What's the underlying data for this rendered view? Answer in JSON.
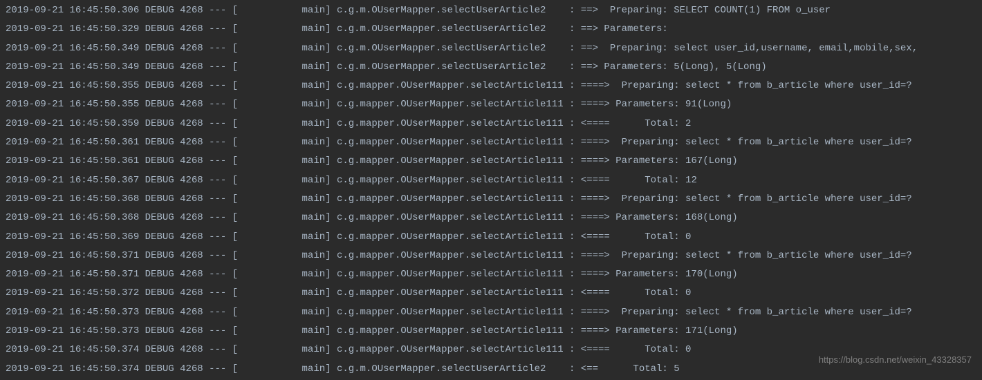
{
  "watermark": "https://blog.csdn.net/weixin_43328357",
  "log_lines": [
    {
      "ts": "2019-09-21 16:45:50.306",
      "level": "DEBUG",
      "pid": "4268",
      "sep": "---",
      "thread": "[           main]",
      "logger": "c.g.m.OUserMapper.selectUserArticle2    ",
      "arrow": ": ==> ",
      "msg": " Preparing: SELECT COUNT(1) FROM o_user "
    },
    {
      "ts": "2019-09-21 16:45:50.329",
      "level": "DEBUG",
      "pid": "4268",
      "sep": "---",
      "thread": "[           main]",
      "logger": "c.g.m.OUserMapper.selectUserArticle2    ",
      "arrow": ": ==> ",
      "msg": "Parameters: "
    },
    {
      "ts": "2019-09-21 16:45:50.349",
      "level": "DEBUG",
      "pid": "4268",
      "sep": "---",
      "thread": "[           main]",
      "logger": "c.g.m.OUserMapper.selectUserArticle2    ",
      "arrow": ": ==> ",
      "msg": " Preparing: select user_id,username, email,mobile,sex,"
    },
    {
      "ts": "2019-09-21 16:45:50.349",
      "level": "DEBUG",
      "pid": "4268",
      "sep": "---",
      "thread": "[           main]",
      "logger": "c.g.m.OUserMapper.selectUserArticle2    ",
      "arrow": ": ==> ",
      "msg": "Parameters: 5(Long), 5(Long)"
    },
    {
      "ts": "2019-09-21 16:45:50.355",
      "level": "DEBUG",
      "pid": "4268",
      "sep": "---",
      "thread": "[           main]",
      "logger": "c.g.mapper.OUserMapper.selectArticle111 ",
      "arrow": ": ====> ",
      "msg": " Preparing: select * from b_article where user_id=?"
    },
    {
      "ts": "2019-09-21 16:45:50.355",
      "level": "DEBUG",
      "pid": "4268",
      "sep": "---",
      "thread": "[           main]",
      "logger": "c.g.mapper.OUserMapper.selectArticle111 ",
      "arrow": ": ====> ",
      "msg": "Parameters: 91(Long)"
    },
    {
      "ts": "2019-09-21 16:45:50.359",
      "level": "DEBUG",
      "pid": "4268",
      "sep": "---",
      "thread": "[           main]",
      "logger": "c.g.mapper.OUserMapper.selectArticle111 ",
      "arrow": ": <====  ",
      "msg": "    Total: 2"
    },
    {
      "ts": "2019-09-21 16:45:50.361",
      "level": "DEBUG",
      "pid": "4268",
      "sep": "---",
      "thread": "[           main]",
      "logger": "c.g.mapper.OUserMapper.selectArticle111 ",
      "arrow": ": ====> ",
      "msg": " Preparing: select * from b_article where user_id=?"
    },
    {
      "ts": "2019-09-21 16:45:50.361",
      "level": "DEBUG",
      "pid": "4268",
      "sep": "---",
      "thread": "[           main]",
      "logger": "c.g.mapper.OUserMapper.selectArticle111 ",
      "arrow": ": ====> ",
      "msg": "Parameters: 167(Long)"
    },
    {
      "ts": "2019-09-21 16:45:50.367",
      "level": "DEBUG",
      "pid": "4268",
      "sep": "---",
      "thread": "[           main]",
      "logger": "c.g.mapper.OUserMapper.selectArticle111 ",
      "arrow": ": <====  ",
      "msg": "    Total: 12"
    },
    {
      "ts": "2019-09-21 16:45:50.368",
      "level": "DEBUG",
      "pid": "4268",
      "sep": "---",
      "thread": "[           main]",
      "logger": "c.g.mapper.OUserMapper.selectArticle111 ",
      "arrow": ": ====> ",
      "msg": " Preparing: select * from b_article where user_id=?"
    },
    {
      "ts": "2019-09-21 16:45:50.368",
      "level": "DEBUG",
      "pid": "4268",
      "sep": "---",
      "thread": "[           main]",
      "logger": "c.g.mapper.OUserMapper.selectArticle111 ",
      "arrow": ": ====> ",
      "msg": "Parameters: 168(Long)"
    },
    {
      "ts": "2019-09-21 16:45:50.369",
      "level": "DEBUG",
      "pid": "4268",
      "sep": "---",
      "thread": "[           main]",
      "logger": "c.g.mapper.OUserMapper.selectArticle111 ",
      "arrow": ": <====  ",
      "msg": "    Total: 0"
    },
    {
      "ts": "2019-09-21 16:45:50.371",
      "level": "DEBUG",
      "pid": "4268",
      "sep": "---",
      "thread": "[           main]",
      "logger": "c.g.mapper.OUserMapper.selectArticle111 ",
      "arrow": ": ====> ",
      "msg": " Preparing: select * from b_article where user_id=?"
    },
    {
      "ts": "2019-09-21 16:45:50.371",
      "level": "DEBUG",
      "pid": "4268",
      "sep": "---",
      "thread": "[           main]",
      "logger": "c.g.mapper.OUserMapper.selectArticle111 ",
      "arrow": ": ====> ",
      "msg": "Parameters: 170(Long)"
    },
    {
      "ts": "2019-09-21 16:45:50.372",
      "level": "DEBUG",
      "pid": "4268",
      "sep": "---",
      "thread": "[           main]",
      "logger": "c.g.mapper.OUserMapper.selectArticle111 ",
      "arrow": ": <====  ",
      "msg": "    Total: 0"
    },
    {
      "ts": "2019-09-21 16:45:50.373",
      "level": "DEBUG",
      "pid": "4268",
      "sep": "---",
      "thread": "[           main]",
      "logger": "c.g.mapper.OUserMapper.selectArticle111 ",
      "arrow": ": ====> ",
      "msg": " Preparing: select * from b_article where user_id=?"
    },
    {
      "ts": "2019-09-21 16:45:50.373",
      "level": "DEBUG",
      "pid": "4268",
      "sep": "---",
      "thread": "[           main]",
      "logger": "c.g.mapper.OUserMapper.selectArticle111 ",
      "arrow": ": ====> ",
      "msg": "Parameters: 171(Long)"
    },
    {
      "ts": "2019-09-21 16:45:50.374",
      "level": "DEBUG",
      "pid": "4268",
      "sep": "---",
      "thread": "[           main]",
      "logger": "c.g.mapper.OUserMapper.selectArticle111 ",
      "arrow": ": <====  ",
      "msg": "    Total: 0"
    },
    {
      "ts": "2019-09-21 16:45:50.374",
      "level": "DEBUG",
      "pid": "4268",
      "sep": "---",
      "thread": "[           main]",
      "logger": "c.g.m.OUserMapper.selectUserArticle2    ",
      "arrow": ": <==   ",
      "msg": "   Total: 5"
    }
  ]
}
